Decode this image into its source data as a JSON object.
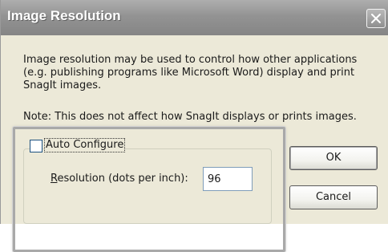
{
  "dialog": {
    "title": "Image Resolution",
    "description": "Image resolution may be used to control how other applications (e.g. publishing programs like Microsoft Word) display and print SnagIt images.",
    "note": "Note: This does not affect how SnagIt displays or prints images.",
    "auto_configure": {
      "label": "Auto Configure",
      "checked": false
    },
    "resolution": {
      "label_mnemonic": "R",
      "label_rest": "esolution (dots per inch):",
      "value": "96"
    },
    "buttons": {
      "ok": "OK",
      "cancel": "Cancel"
    },
    "icons": {
      "close": "close-icon"
    }
  }
}
